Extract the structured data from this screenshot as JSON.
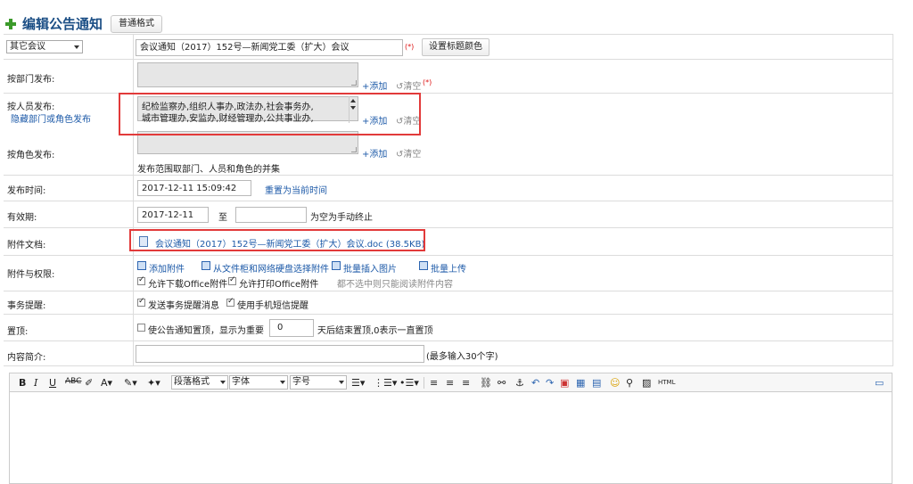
{
  "header": {
    "title": "编辑公告通知",
    "format_button": "普通格式"
  },
  "title_row": {
    "category": "其它会议",
    "title_value": "会议通知（2017）152号—新闻党工委（扩大）会议",
    "required_mark": "(*)",
    "title_color_button": "设置标题颜色"
  },
  "dept_row": {
    "label": "按部门发布:",
    "add": "添加",
    "clear": "清空",
    "required_mark": "(*)"
  },
  "person_row": {
    "label": "按人员发布:",
    "hide_link": "隐藏部门或角色发布",
    "value_line1": "纪检监察办,组织人事办,政法办,社会事务办,",
    "value_line2": "城市管理办,安监办,财经管理办,公共事业办,",
    "add": "添加",
    "clear": "清空"
  },
  "role_row": {
    "label": "按角色发布:",
    "add": "添加",
    "clear": "清空",
    "note": "发布范围取部门、人员和角色的并集"
  },
  "publish_row": {
    "label": "发布时间:",
    "value": "2017-12-11 15:09:42",
    "reset_link": "重置为当前时间"
  },
  "valid_row": {
    "label": "有效期:",
    "start": "2017-12-11",
    "to": "至",
    "end": "",
    "note": "为空为手动终止"
  },
  "attach_row": {
    "label": "附件文档:",
    "file": "会议通知（2017）152号—新闻党工委（扩大）会议.doc (38.5KB)"
  },
  "perm_row": {
    "label": "附件与权限:",
    "add_attachment": "添加附件",
    "from_disk": "从文件柜和网络硬盘选择附件",
    "insert_images": "批量插入图片",
    "batch_upload": "批量上传",
    "allow_download": "允许下载Office附件",
    "allow_print": "允许打印Office附件",
    "note": "都不选中则只能阅读附件内容"
  },
  "reminder_row": {
    "label": "事务提醒:",
    "send_reminder": "发送事务提醒消息",
    "sms_reminder": "使用手机短信提醒"
  },
  "top_row": {
    "label": "置顶:",
    "text1": "使公告通知置顶，显示为重要",
    "days": "0",
    "text2": "天后结束置顶,0表示一直置顶"
  },
  "summary_row": {
    "label": "内容简介:",
    "value": "",
    "note": "(最多输入30个字)"
  },
  "editor": {
    "paragraph": "段落格式",
    "font": "字体",
    "size": "字号",
    "html": "HTML"
  }
}
